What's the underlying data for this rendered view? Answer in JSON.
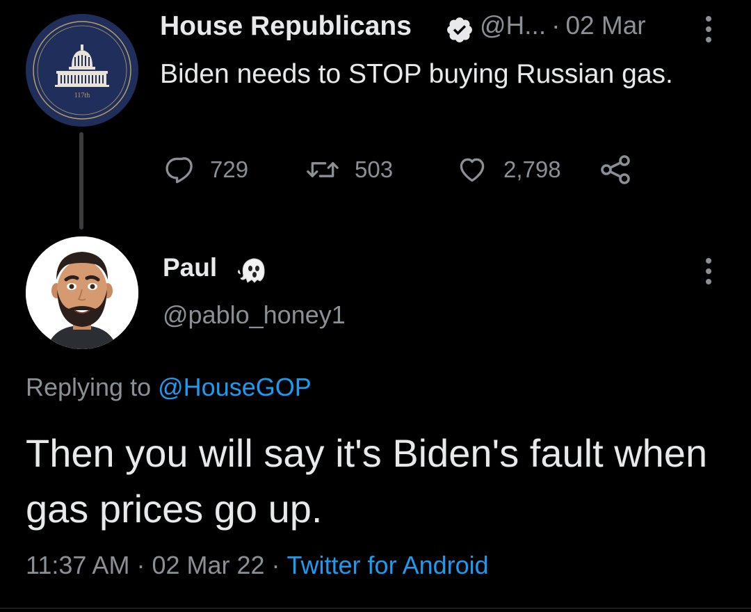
{
  "parent_tweet": {
    "author_name": "House Republicans",
    "handle_truncated": "@H...",
    "date": "02 Mar",
    "separator": "·",
    "text": "Biden needs to STOP buying Russian gas.",
    "avatar_caption": "117th",
    "reply_count": "729",
    "retweet_count": "503",
    "like_count": "2,798",
    "icons": {
      "verified": "verified-badge-icon",
      "reply": "reply-bubble-icon",
      "retweet": "retweet-icon",
      "like": "heart-icon",
      "share": "share-icon",
      "more": "more-vertical-icon"
    }
  },
  "reply_tweet": {
    "author_name": "Paul",
    "handle": "@pablo_honey1",
    "name_emoji": "ghost-icon",
    "replying_prefix": "Replying to",
    "replying_to": "@HouseGOP",
    "text": "Then you will say it's Biden's fault when gas prices go up.",
    "time": "11:37 AM",
    "date": "02 Mar 22",
    "separator": "·",
    "source": "Twitter for Android",
    "icons": {
      "more": "more-vertical-icon",
      "avatar": "memoji-avatar"
    }
  },
  "colors": {
    "background": "#000000",
    "primary_text": "#e7e9ea",
    "secondary_text": "#8b9096",
    "link": "#1d9bf0",
    "verified": "#e7e9ea",
    "avatar_gop_bg": "#1f2e5a",
    "thread_line": "#3a3d40"
  }
}
